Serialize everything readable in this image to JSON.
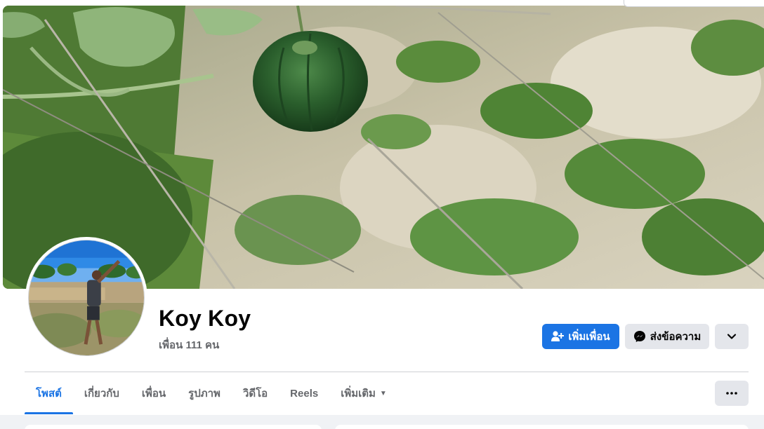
{
  "profile": {
    "name": "Koy Koy",
    "friends_text": "เพื่อน 111 คน"
  },
  "actions": {
    "add_friend_label": "เพิ่มเพื่อน",
    "message_label": "ส่งข้อความ",
    "add_friend_icon": "person-add-icon",
    "message_icon": "messenger-icon",
    "dropdown_icon": "chevron-down-icon"
  },
  "tabs": [
    {
      "label": "โพสต์",
      "active": true
    },
    {
      "label": "เกี่ยวกับ",
      "active": false
    },
    {
      "label": "เพื่อน",
      "active": false
    },
    {
      "label": "รูปภาพ",
      "active": false
    },
    {
      "label": "วิดีโอ",
      "active": false
    },
    {
      "label": "Reels",
      "active": false
    },
    {
      "label": "เพิ่มเติม",
      "active": false,
      "has_caret": true
    }
  ],
  "more_icon": "ellipsis-icon",
  "colors": {
    "accent": "#1b74e4",
    "secondary_button": "#e4e6eb",
    "muted_text": "#65676b",
    "page_bg": "#f0f2f5"
  }
}
